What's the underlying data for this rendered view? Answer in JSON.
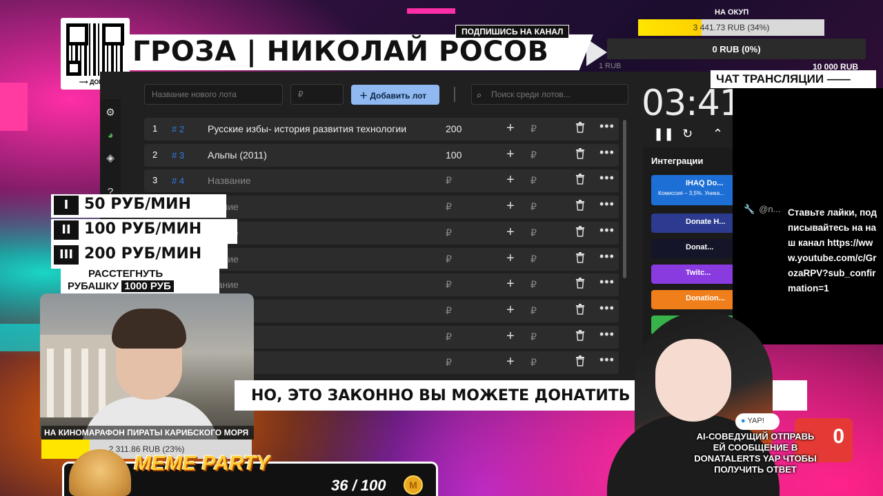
{
  "qr": {
    "label": "⟶ ДОНАТ"
  },
  "header": {
    "title": "ГРОЗА | НИКОЛАЙ РОСОВ",
    "subscribe": "ПОДПИШИСЬ НА КАНАЛ"
  },
  "goals": {
    "payback_label": "НА ОКУП",
    "payback_value": "3 441.73 RUB (34%)",
    "payback_fraction": 0.34,
    "second_value": "0 RUB (0%)",
    "second_min": "1 RUB",
    "second_max": "10 000 RUB"
  },
  "chat": {
    "header": "ЧАТ ТРАНСЛЯЦИИ ——",
    "messages": [
      {
        "user": "@n...",
        "text": "Ставьте лайки, подписывайтесь на наш канал https://www.youtube.com/c/GrozaRPV?sub_confirmation=1"
      }
    ]
  },
  "app": {
    "lot_name_placeholder": "Название нового лота",
    "lot_amount_placeholder": "₽",
    "add_button": "Добавить лот",
    "search_placeholder": "Поиск среди лотов...",
    "timer": "03:41",
    "integrations_title": "Интеграции",
    "integrations": [
      {
        "label": "IHAQ Do...",
        "sub": "Комиссия – 3,5%. Уника...",
        "color": "#1d6fd6"
      },
      {
        "label": "Donate H...",
        "color": "#2c3b8f"
      },
      {
        "label": "Donat...",
        "color": "#151529"
      },
      {
        "label": "Twitc...",
        "color": "#8a3be0"
      },
      {
        "label": "Donation...",
        "color": "#ef7e1b"
      },
      {
        "label": "",
        "color": "#37b34a"
      }
    ],
    "rows": [
      {
        "num": "1",
        "idx": "# 2",
        "name": "Русские избы- история развития технологии",
        "amount": "200",
        "placeholder": false
      },
      {
        "num": "2",
        "idx": "# 3",
        "name": "Альпы (2011)",
        "amount": "100",
        "placeholder": false
      },
      {
        "num": "3",
        "idx": "# 4",
        "name": "Название",
        "amount": "₽",
        "placeholder": true
      },
      {
        "num": "",
        "idx": "",
        "name": "звание",
        "amount": "₽",
        "placeholder": true
      },
      {
        "num": "",
        "idx": "",
        "name": "звание",
        "amount": "₽",
        "placeholder": true
      },
      {
        "num": "",
        "idx": "",
        "name": "звание",
        "amount": "₽",
        "placeholder": true
      },
      {
        "num": "",
        "idx": "",
        "name": "звание",
        "amount": "₽",
        "placeholder": true
      },
      {
        "num": "",
        "idx": "",
        "name": "",
        "amount": "₽",
        "placeholder": true
      },
      {
        "num": "",
        "idx": "",
        "name": "",
        "amount": "₽",
        "placeholder": true
      },
      {
        "num": "",
        "idx": "",
        "name": "",
        "amount": "₽",
        "placeholder": true
      }
    ],
    "row_rub": "₽"
  },
  "tiers": [
    {
      "badge": "I",
      "text": "50 РУБ/МИН"
    },
    {
      "badge": "II",
      "text": "100 РУБ/МИН"
    },
    {
      "badge": "III",
      "text": "200 РУБ/МИН"
    }
  ],
  "shirt": {
    "line1": "РАССТЕГНУТЬ",
    "line2": "РУБАШКУ",
    "price": "1000 РУБ"
  },
  "cam": {
    "caption": "НА КИНОМАРАФОН ПИРАТЫ КАРИБСКОГО МОРЯ",
    "goal_value": "2 311.86 RUB (23%)",
    "goal_fraction": 0.23
  },
  "ticker": {
    "text": "НО, ЭТО ЗАКОННО ВЫ МОЖЕТЕ ДОНАТИТЬ М      ОЛОТН"
  },
  "meme": {
    "title": "MEME PARTY",
    "count": "36 / 100",
    "coin": "M"
  },
  "ai": {
    "bubble": "YAP!",
    "rec": "0",
    "text": "AI-СОВЕДУЩИЙ ОТПРАВЬ ЕЙ СООБЩЕНИЕ В DONATALERTS YAP ЧТОБЫ ПОЛУЧИТЬ ОТВЕТ"
  }
}
